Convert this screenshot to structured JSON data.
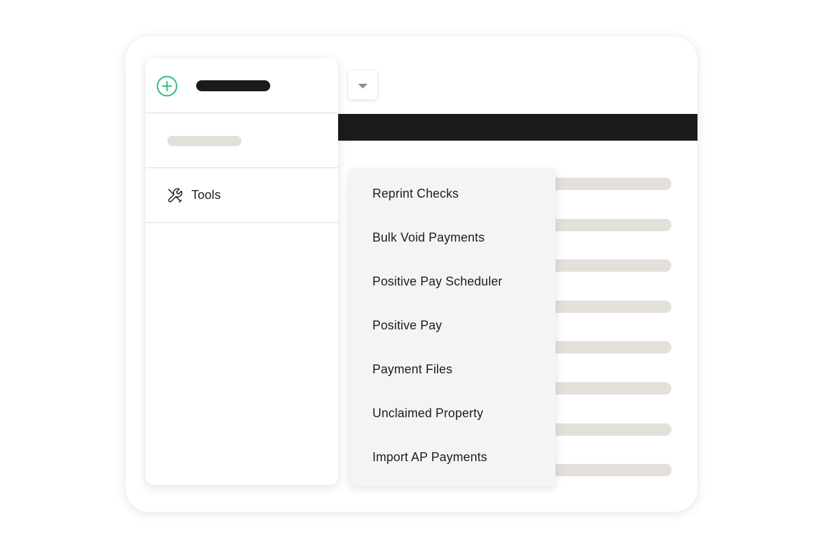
{
  "colors": {
    "accent": "#2ebc7a",
    "dark": "#1b1b1b",
    "placeholder": "#e3e0da",
    "menu_bg": "#f4f4f4"
  },
  "sidebar": {
    "add_icon": "plus-circle-icon",
    "tools": {
      "icon": "wrench-screwdriver-icon",
      "label": "Tools"
    }
  },
  "toolbar": {
    "dropdown_icon": "caret-down-icon"
  },
  "tools_menu": {
    "items": [
      "Reprint Checks",
      "Bulk Void Payments",
      "Positive Pay Scheduler",
      "Positive Pay",
      "Payment Files",
      "Unclaimed Property",
      "Import AP Payments"
    ]
  }
}
